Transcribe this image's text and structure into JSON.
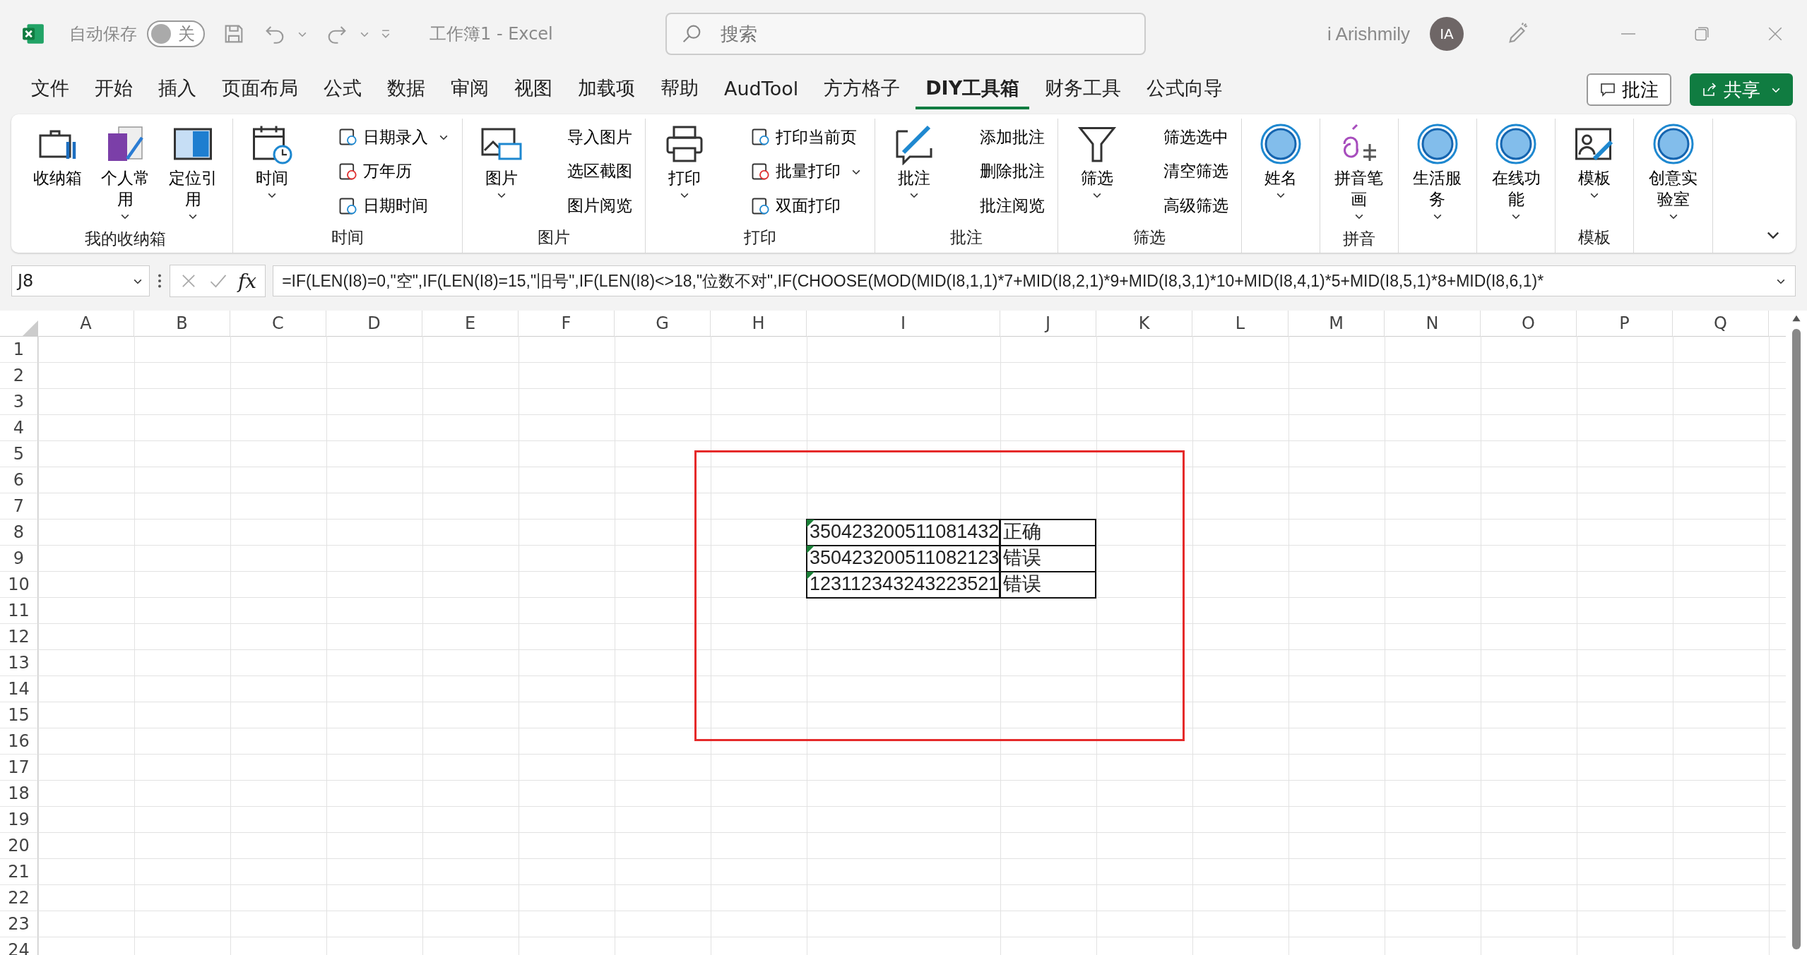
{
  "titlebar": {
    "autosave_label": "自动保存",
    "autosave": {
      "on": false,
      "label": "关"
    },
    "title": "工作簿1  -  Excel",
    "search": {
      "placeholder": "搜索"
    },
    "user": "i Arishmily",
    "avatar": "IA"
  },
  "tabs": [
    {
      "label": "文件",
      "selected": false
    },
    {
      "label": "开始",
      "selected": false
    },
    {
      "label": "插入",
      "selected": false
    },
    {
      "label": "页面布局",
      "selected": false
    },
    {
      "label": "公式",
      "selected": false
    },
    {
      "label": "数据",
      "selected": false
    },
    {
      "label": "审阅",
      "selected": false
    },
    {
      "label": "视图",
      "selected": false
    },
    {
      "label": "加载项",
      "selected": false
    },
    {
      "label": "帮助",
      "selected": false
    },
    {
      "label": "AudTool",
      "selected": false
    },
    {
      "label": "方方格子",
      "selected": false
    },
    {
      "label": "DIY工具箱",
      "selected": true
    },
    {
      "label": "财务工具",
      "selected": false
    },
    {
      "label": "公式向导",
      "selected": false
    }
  ],
  "tab_actions": {
    "comments": "批注",
    "share": "共享"
  },
  "ribbon": [
    {
      "label": "我的收纳箱",
      "items": [
        {
          "kind": "large",
          "label": "收纳箱",
          "caret": false
        },
        {
          "kind": "large",
          "label": "个人常用",
          "caret": true
        },
        {
          "kind": "large",
          "label": "定位引用",
          "caret": true
        }
      ]
    },
    {
      "label": "时间",
      "items": [
        {
          "kind": "large",
          "label": "时间",
          "caret": true
        },
        {
          "kind": "small",
          "label": "日期录入",
          "caret": true
        },
        {
          "kind": "small",
          "label": "万年历",
          "caret": false
        },
        {
          "kind": "small",
          "label": "日期时间",
          "caret": false
        }
      ]
    },
    {
      "label": "图片",
      "items": [
        {
          "kind": "large",
          "label": "图片",
          "caret": true
        },
        {
          "kind": "plain",
          "label": "导入图片",
          "caret": false
        },
        {
          "kind": "plain",
          "label": "选区截图",
          "caret": false
        },
        {
          "kind": "plain",
          "label": "图片阅览",
          "caret": false
        }
      ]
    },
    {
      "label": "打印",
      "items": [
        {
          "kind": "large",
          "label": "打印",
          "caret": true
        },
        {
          "kind": "small",
          "label": "打印当前页",
          "caret": false
        },
        {
          "kind": "small",
          "label": "批量打印",
          "caret": true
        },
        {
          "kind": "small",
          "label": "双面打印",
          "caret": false
        }
      ]
    },
    {
      "label": "批注",
      "items": [
        {
          "kind": "large",
          "label": "批注",
          "caret": true
        },
        {
          "kind": "plain",
          "label": "添加批注",
          "caret": false
        },
        {
          "kind": "plain",
          "label": "删除批注",
          "caret": false
        },
        {
          "kind": "plain",
          "label": "批注阅览",
          "caret": false
        }
      ]
    },
    {
      "label": "筛选",
      "items": [
        {
          "kind": "large",
          "label": "筛选",
          "caret": true
        },
        {
          "kind": "plain",
          "label": "筛选选中",
          "caret": false
        },
        {
          "kind": "plain",
          "label": "清空筛选",
          "caret": false
        },
        {
          "kind": "plain",
          "label": "高级筛选",
          "caret": false
        }
      ]
    },
    {
      "items": [
        {
          "kind": "large",
          "label": "姓名",
          "caret": true
        }
      ]
    },
    {
      "label": "拼音",
      "items": [
        {
          "kind": "large",
          "label": "拼音笔画",
          "caret": true
        }
      ]
    },
    {
      "items": [
        {
          "kind": "large",
          "label": "生活服务",
          "caret": true
        }
      ]
    },
    {
      "items": [
        {
          "kind": "large",
          "label": "在线功能",
          "caret": true
        }
      ]
    },
    {
      "label": "模板",
      "items": [
        {
          "kind": "large",
          "label": "模板",
          "caret": true
        }
      ]
    },
    {
      "items": [
        {
          "kind": "large",
          "label": "创意实验室",
          "caret": true
        }
      ]
    }
  ],
  "formula_bar": {
    "name_box": "J8",
    "fx": "fx",
    "formula": "=IF(LEN(I8)=0,\"空\",IF(LEN(I8)=15,\"旧号\",IF(LEN(I8)<>18,\"位数不对\",IF(CHOOSE(MOD(MID(I8,1,1)*7+MID(I8,2,1)*9+MID(I8,3,1)*10+MID(I8,4,1)*5+MID(I8,5,1)*8+MID(I8,6,1)*"
  },
  "sheet": {
    "columns": [
      "A",
      "B",
      "C",
      "D",
      "E",
      "F",
      "G",
      "H",
      "I",
      "J",
      "K",
      "L",
      "M",
      "N",
      "O",
      "P",
      "Q"
    ],
    "rows": [
      {
        "label": "1"
      },
      {
        "label": "2"
      },
      {
        "label": "3"
      },
      {
        "label": "4"
      },
      {
        "label": "5"
      },
      {
        "label": "6"
      },
      {
        "label": "7"
      },
      {
        "label": "8",
        "cells": {
          "I": {
            "text": "350423200511081432",
            "flagged": true
          },
          "J": {
            "text": "正确"
          }
        }
      },
      {
        "label": "9",
        "cells": {
          "I": {
            "text": "350423200511082123",
            "flagged": true
          },
          "J": {
            "text": "错误"
          }
        }
      },
      {
        "label": "10",
        "cells": {
          "I": {
            "text": "123112343243223521",
            "flagged": true
          },
          "J": {
            "text": "错误"
          }
        }
      },
      {
        "label": "11"
      },
      {
        "label": "12"
      },
      {
        "label": "13"
      },
      {
        "label": "14"
      },
      {
        "label": "15"
      },
      {
        "label": "16"
      },
      {
        "label": "17"
      },
      {
        "label": "18"
      },
      {
        "label": "19"
      },
      {
        "label": "20"
      },
      {
        "label": "21"
      },
      {
        "label": "22"
      },
      {
        "label": "23"
      },
      {
        "label": "24"
      }
    ]
  }
}
